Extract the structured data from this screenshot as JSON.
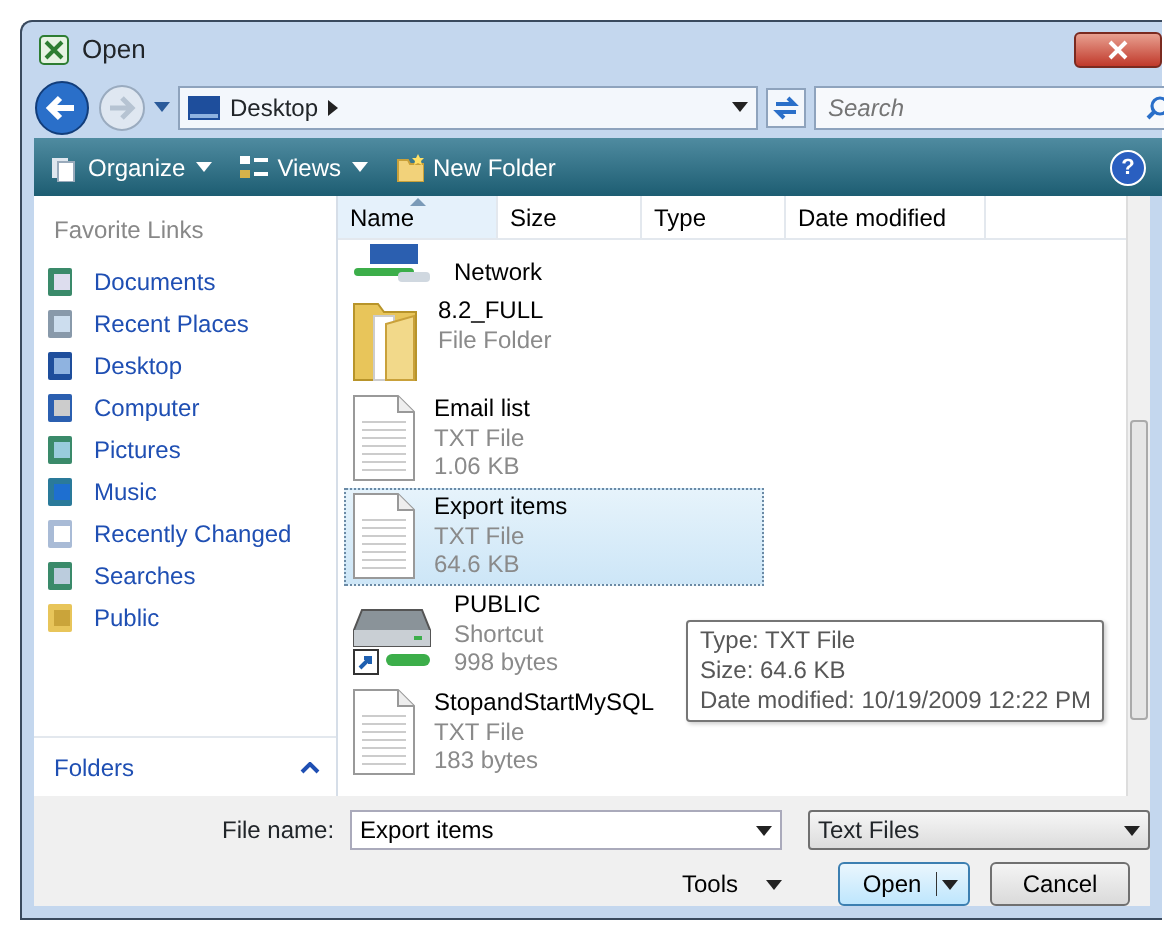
{
  "window": {
    "title": "Open"
  },
  "nav": {
    "location": "Desktop",
    "search_placeholder": "Search"
  },
  "toolbar": [
    {
      "label": "Organize",
      "kind": "organize",
      "dropdown": true
    },
    {
      "label": "Views",
      "kind": "views",
      "dropdown": true
    },
    {
      "label": "New Folder",
      "kind": "folder",
      "dropdown": false
    }
  ],
  "help": "?",
  "sidebar": {
    "heading": "Favorite Links",
    "items": [
      {
        "label": "Documents",
        "kind": "documents"
      },
      {
        "label": "Recent Places",
        "kind": "recent"
      },
      {
        "label": "Desktop",
        "kind": "desktop"
      },
      {
        "label": "Computer",
        "kind": "computer"
      },
      {
        "label": "Pictures",
        "kind": "pictures"
      },
      {
        "label": "Music",
        "kind": "music"
      },
      {
        "label": "Recently Changed",
        "kind": "changed"
      },
      {
        "label": "Searches",
        "kind": "searches"
      },
      {
        "label": "Public",
        "kind": "public"
      }
    ],
    "folders": "Folders"
  },
  "columns": [
    {
      "label": "Name",
      "sorted": true
    },
    {
      "label": "Size",
      "sorted": false
    },
    {
      "label": "Type",
      "sorted": false
    },
    {
      "label": "Date modified",
      "sorted": false
    }
  ],
  "files": [
    {
      "name": "Network",
      "kind": "network",
      "selected": false
    },
    {
      "name": "8.2_FULL",
      "type": "File Folder",
      "kind": "folder",
      "selected": false
    },
    {
      "name": "Email list",
      "type": "TXT File",
      "size": "1.06 KB",
      "kind": "text",
      "selected": false
    },
    {
      "name": "Export items",
      "type": "TXT File",
      "size": "64.6 KB",
      "kind": "text",
      "selected": true
    },
    {
      "name": "PUBLIC",
      "type": "Shortcut",
      "size": "998 bytes",
      "kind": "shortcut",
      "selected": false
    },
    {
      "name": "StopandStartMySQL",
      "type": "TXT File",
      "size": "183 bytes",
      "kind": "text",
      "selected": false
    }
  ],
  "tooltip": [
    "Type: TXT File",
    "Size: 64.6 KB",
    "Date modified: 10/19/2009 12:22 PM"
  ],
  "file_name": {
    "label": "File name:",
    "value": "Export items"
  },
  "file_type": "Text Files",
  "buttons": [
    {
      "label": "Tools",
      "kind": "menu"
    },
    {
      "label": "Open",
      "kind": "split"
    },
    {
      "label": "Cancel",
      "kind": "plain"
    }
  ]
}
